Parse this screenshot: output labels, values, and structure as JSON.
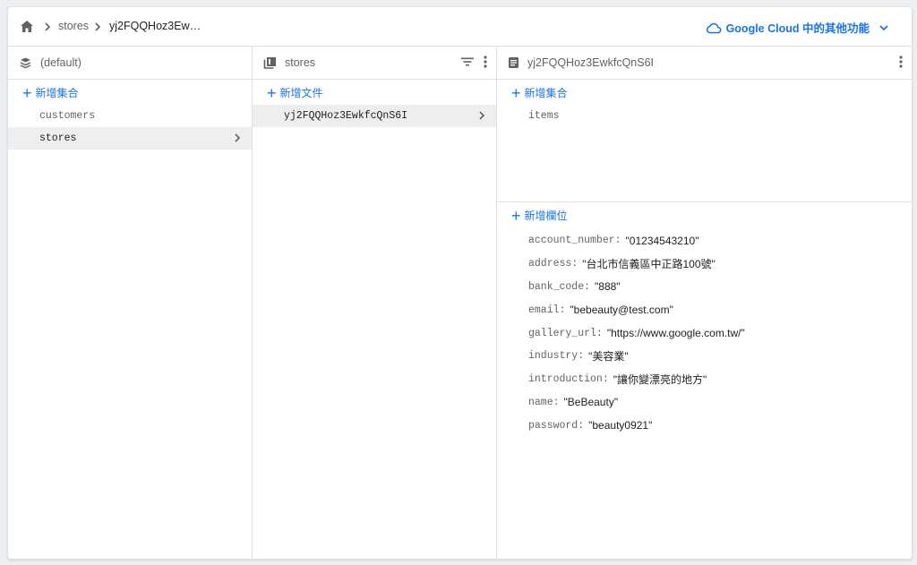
{
  "breadcrumb": {
    "items": [
      "stores",
      "yj2FQQHoz3Ew…"
    ]
  },
  "header": {
    "gcloud_label": "Google Cloud 中的其他功能"
  },
  "columns": {
    "root": {
      "title": "(default)",
      "add_label": "新增集合",
      "items": [
        {
          "label": "customers"
        },
        {
          "label": "stores"
        }
      ]
    },
    "collection": {
      "title": "stores",
      "add_label": "新增文件",
      "items": [
        {
          "label": "yj2FQQHoz3EwkfcQnS6I"
        }
      ]
    },
    "document": {
      "title": "yj2FQQHoz3EwkfcQnS6I",
      "add_collection_label": "新增集合",
      "subcollections": [
        {
          "label": "items"
        }
      ],
      "add_field_label": "新增欄位",
      "fields": [
        {
          "key": "account_number:",
          "value": "\"01234543210\""
        },
        {
          "key": "address:",
          "value": "\"台北市信義區中正路100號\""
        },
        {
          "key": "bank_code:",
          "value": "\"888\""
        },
        {
          "key": "email:",
          "value": "\"bebeauty@test.com\""
        },
        {
          "key": "gallery_url:",
          "value": "\"https://www.google.com.tw/\""
        },
        {
          "key": "industry:",
          "value": "\"美容業\""
        },
        {
          "key": "introduction:",
          "value": "\"讓你變漂亮的地方\""
        },
        {
          "key": "name:",
          "value": "\"BeBeauty\""
        },
        {
          "key": "password:",
          "value": "\"beauty0921\""
        }
      ]
    }
  },
  "colors": {
    "accent": "#1a73e8",
    "selected_bg": "#eeeeee",
    "muted_text": "#5f6368"
  },
  "icons": {
    "home": "home-icon",
    "breadcrumb_separator": "chevron-right-icon",
    "cloud": "cloud-icon",
    "dropdown": "chevron-down-icon",
    "database": "database-stack-icon",
    "collection": "collection-icon",
    "filter": "filter-icon",
    "more": "more-vert-icon",
    "document": "document-icon"
  }
}
